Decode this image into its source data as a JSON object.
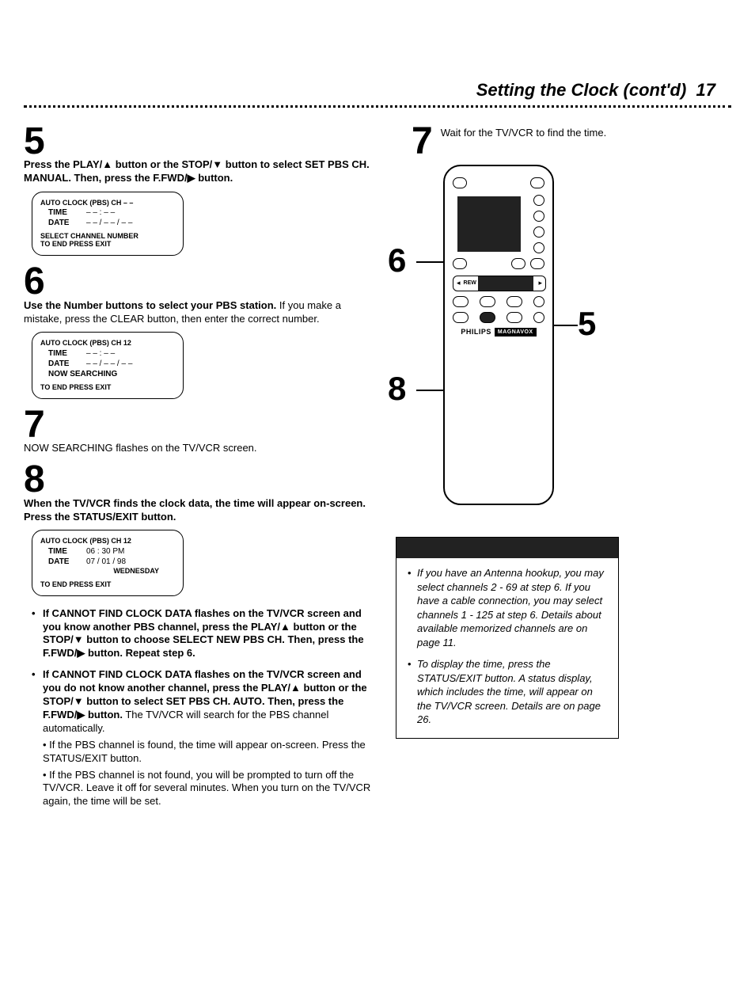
{
  "page": {
    "title": "Setting the Clock (cont'd)",
    "number": "17"
  },
  "step5": {
    "num": "5",
    "text_a": "Press the ",
    "play": "PLAY/",
    "text_b": " button or the ",
    "stop": "STOP/",
    "text_c": " button to select SET PBS CH. MANUAL. Then, press the ",
    "ffwd": "F.FWD/",
    "text_d": " button."
  },
  "osd1": {
    "hdr": "AUTO CLOCK (PBS) CH – –",
    "time_lbl": "TIME",
    "time_val": "– – : – –",
    "date_lbl": "DATE",
    "date_val": "– – / – – / – –",
    "foot1": "SELECT CHANNEL NUMBER",
    "foot2": "TO END PRESS EXIT"
  },
  "step6": {
    "num": "6",
    "bold": "Use the Number buttons to select your PBS station.",
    "rest": " If you make a mistake, press the CLEAR button, then enter the correct number."
  },
  "osd2": {
    "hdr": "AUTO CLOCK (PBS) CH 12",
    "time_lbl": "TIME",
    "time_val": "– – : – –",
    "date_lbl": "DATE",
    "date_val": "– – / – – / – –",
    "mid": "NOW SEARCHING",
    "foot": "TO END PRESS EXIT"
  },
  "step7l": {
    "num": "7",
    "text": "NOW SEARCHING flashes on the TV/VCR screen."
  },
  "step8": {
    "num": "8",
    "bold": "When the TV/VCR finds the clock data, the time will appear on-screen. Press the STATUS/EXIT button."
  },
  "osd3": {
    "hdr": "AUTO CLOCK (PBS) CH 12",
    "time_lbl": "TIME",
    "time_val": "06 : 30 PM",
    "date_lbl": "DATE",
    "date_val": "07 / 01 / 98",
    "day": "WEDNESDAY",
    "foot": "TO END PRESS EXIT"
  },
  "bullets": {
    "b1a": "If CANNOT FIND CLOCK DATA flashes on the TV/VCR screen and you know another PBS channel, press the PLAY/",
    "b1b": " button or the STOP/",
    "b1c": " button to choose SELECT NEW PBS CH. Then, press the F.FWD/",
    "b1d": " button. Repeat step 6.",
    "b2a": "If CANNOT FIND CLOCK DATA flashes on the TV/VCR screen and you do not know another channel, press the PLAY/",
    "b2b": " button or the STOP/",
    "b2c": " button to select SET PBS CH. AUTO. Then, press the F.FWD/",
    "b2d": " button.",
    "b2rest": " The TV/VCR will search for the PBS channel automatically.",
    "sub1": "If the PBS channel is found, the time will appear on-screen. Press the STATUS/EXIT button.",
    "sub2": "If the PBS channel is not found, you will be prompted to turn off the TV/VCR. Leave it off for several minutes. When you turn on the TV/VCR again, the time will be set."
  },
  "step7r": {
    "num": "7",
    "text": "Wait for the TV/VCR to find the time."
  },
  "callouts": {
    "c6": "6",
    "c5": "5",
    "c8": "8"
  },
  "remote": {
    "brand": "PHILIPS",
    "brandbox": "MAGNAVOX",
    "rew": "REW"
  },
  "tips": {
    "t1": "If you have an Antenna hookup, you may select channels 2 - 69 at step 6. If you have a cable connection, you may select channels 1 - 125 at step 6. Details about available memorized channels are on page 11.",
    "t2": "To display the time, press the STATUS/EXIT button. A status display, which includes the time, will appear on the TV/VCR screen. Details are on page 26."
  }
}
